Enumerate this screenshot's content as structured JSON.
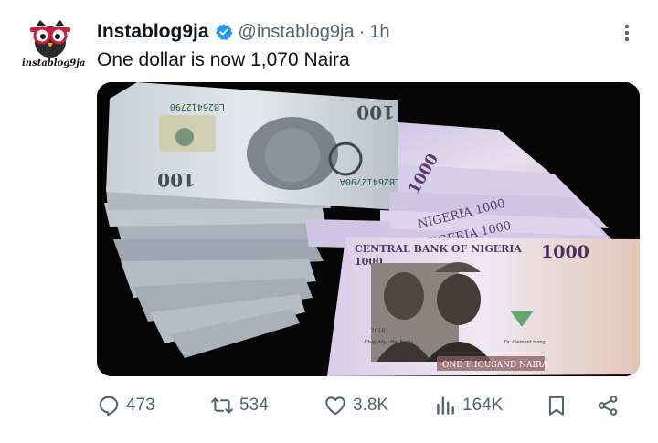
{
  "tweet": {
    "avatar": {
      "label": "instablog9ja",
      "icon": "owl-logo-icon"
    },
    "display_name": "Instablog9ja",
    "verified_icon": "verified-badge-icon",
    "handle": "@instablog9ja",
    "separator": "·",
    "time": "1h",
    "text": "One dollar is now 1,070 Naira",
    "media": {
      "usd_note": {
        "denomination": "100",
        "serial": "LB26412790",
        "serial2": "LB26412790A"
      },
      "naira_note": {
        "bank": "CENTRAL BANK OF NIGERIA",
        "denomination": "1000",
        "stack_label": "NIGERIA 1000",
        "amount_words": "ONE THOUSAND NAIRA",
        "year": "2016",
        "name_left": "Alhaji Aliyu Mai Bornu",
        "name_right": "Dr. Clement Isong"
      }
    },
    "actions": {
      "replies": "473",
      "reposts": "534",
      "likes": "3.8K",
      "views": "164K"
    }
  },
  "colors": {
    "text_primary": "#0f1419",
    "text_secondary": "#536471",
    "verified": "#1d9bf0",
    "media_bg": "#050505"
  }
}
